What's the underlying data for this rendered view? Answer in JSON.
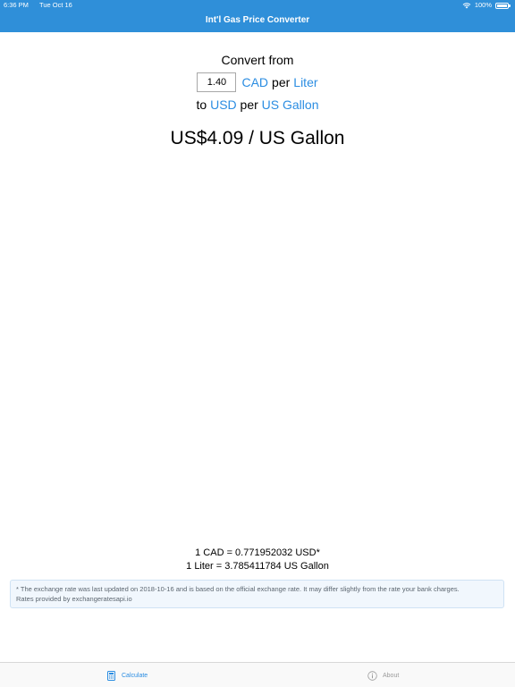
{
  "status_bar": {
    "time": "6:36 PM",
    "date": "Tue Oct 16",
    "battery": "100%",
    "wifi_icon": "wifi-icon",
    "battery_icon": "battery-icon"
  },
  "header": {
    "title": "Int'l Gas Price Converter",
    "background_color": "#2f8fd9"
  },
  "converter": {
    "convert_from_label": "Convert from",
    "amount_value": "1.40",
    "from_currency": "CAD",
    "per_word_1": "per",
    "from_unit": "Liter",
    "to_word": "to",
    "to_currency": "USD",
    "per_word_2": "per",
    "to_unit": "US Gallon",
    "link_color": "#2b8de2"
  },
  "result": {
    "text": "US$4.09 / US Gallon"
  },
  "rates": {
    "currency_rate": "1 CAD = 0.771952032 USD*",
    "unit_rate": "1 Liter = 3.785411784 US Gallon"
  },
  "note": {
    "line1": "* The exchange rate was last updated on 2018-10-16 and is based on the official exchange rate. It may differ slightly from the rate your bank charges.",
    "line2": "Rates provided by exchangeratesapi.io"
  },
  "tab_bar": {
    "tabs": [
      {
        "label": "Calculate",
        "icon": "calculator-icon",
        "active": true
      },
      {
        "label": "About",
        "icon": "info-icon",
        "active": false
      }
    ]
  }
}
